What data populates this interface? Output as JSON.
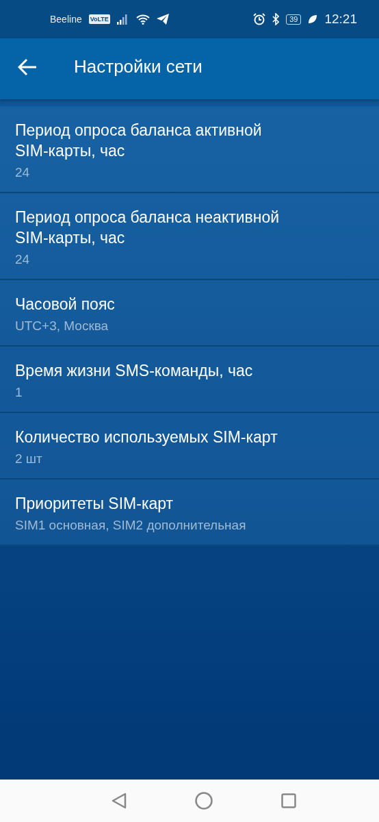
{
  "status_bar": {
    "carrier": "Beeline",
    "volte_badge": "VoLTE",
    "battery": "39",
    "time": "12:21"
  },
  "app_bar": {
    "title": "Настройки сети"
  },
  "settings": [
    {
      "title": "Период опроса баланса активной SIM-карты, час",
      "value": "24"
    },
    {
      "title": "Период опроса баланса неактивной SIM-карты, час",
      "value": "24"
    },
    {
      "title": "Часовой пояс",
      "value": "UTC+3, Москва"
    },
    {
      "title": "Время жизни SMS-команды, час",
      "value": "1"
    },
    {
      "title": "Количество используемых SIM-карт",
      "value": "2 шт"
    },
    {
      "title": "Приоритеты SIM-карт",
      "value": "SIM1 основная, SIM2 дополнительная"
    }
  ]
}
